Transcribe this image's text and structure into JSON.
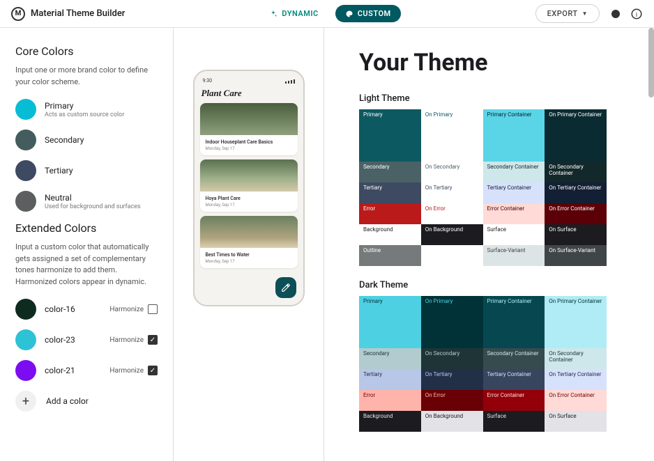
{
  "app_title": "Material Theme Builder",
  "modes": {
    "dynamic": "DYNAMIC",
    "custom": "CUSTOM"
  },
  "export_label": "EXPORT",
  "core_colors": {
    "title": "Core Colors",
    "description": "Input one or more brand color to define your color scheme.",
    "items": [
      {
        "name": "Primary",
        "sub": "Acts as custom source color",
        "hex": "#07bdd5"
      },
      {
        "name": "Secondary",
        "sub": "",
        "hex": "#445c5e"
      },
      {
        "name": "Tertiary",
        "sub": "",
        "hex": "#3d4a61"
      },
      {
        "name": "Neutral",
        "sub": "Used for background and surfaces",
        "hex": "#5c5f5f"
      }
    ]
  },
  "extended_colors": {
    "title": "Extended Colors",
    "description": "Input a custom color that automatically gets assigned a set of complementary tones harmonize to add them. Harmonized colors appear in dynamic.",
    "items": [
      {
        "name": "color-16",
        "hex": "#0f2b1f",
        "harmonize": false
      },
      {
        "name": "color-23",
        "hex": "#2ec2d6",
        "harmonize": true
      },
      {
        "name": "color-21",
        "hex": "#7c0df2",
        "harmonize": true
      }
    ],
    "harmonize_label": "Harmonize",
    "add_label": "Add a color"
  },
  "preview": {
    "time": "9:30",
    "app_name": "Plant Care",
    "cards": [
      {
        "title": "Indoor Houseplant Care Basics",
        "date": "Monday, Sep 17"
      },
      {
        "title": "Hoya Plant Care",
        "date": "Monday, Sep 17"
      },
      {
        "title": "Best Times to Water",
        "date": "Monday, Sep 17"
      }
    ]
  },
  "theme": {
    "heading": "Your Theme",
    "light_label": "Light Theme",
    "dark_label": "Dark Theme",
    "light": [
      [
        {
          "l": "Primary",
          "bg": "#0d5961",
          "fg": "#fff"
        },
        {
          "l": "On Primary",
          "bg": "#ffffff",
          "fg": "#0d5961"
        },
        {
          "l": "Primary Container",
          "bg": "#5ad5e8",
          "fg": "#05222a"
        },
        {
          "l": "On Primary Container",
          "bg": "#0a2b32",
          "fg": "#fff"
        }
      ],
      [
        {
          "l": "Secondary",
          "bg": "#4a6265",
          "fg": "#fff"
        },
        {
          "l": "On Secondary",
          "bg": "#ffffff",
          "fg": "#4a6265"
        },
        {
          "l": "Secondary Container",
          "bg": "#cde7ea",
          "fg": "#13282b"
        },
        {
          "l": "On Secondary Container",
          "bg": "#13282b",
          "fg": "#fff"
        }
      ],
      [
        {
          "l": "Tertiary",
          "bg": "#3d4a61",
          "fg": "#fff"
        },
        {
          "l": "On Tertiary",
          "bg": "#ffffff",
          "fg": "#3d4a61"
        },
        {
          "l": "Tertiary Container",
          "bg": "#d7e1fb",
          "fg": "#131f35"
        },
        {
          "l": "On Tertiary Container",
          "bg": "#131f35",
          "fg": "#fff"
        }
      ],
      [
        {
          "l": "Error",
          "bg": "#ba1a1a",
          "fg": "#fff"
        },
        {
          "l": "On Error",
          "bg": "#ffffff",
          "fg": "#ba1a1a"
        },
        {
          "l": "Error Container",
          "bg": "#ffdad6",
          "fg": "#410002"
        },
        {
          "l": "On Error Container",
          "bg": "#5c0007",
          "fg": "#fff"
        }
      ],
      [
        {
          "l": "Background",
          "bg": "#ffffff",
          "fg": "#1c1b1f"
        },
        {
          "l": "On Background",
          "bg": "#1c1b1f",
          "fg": "#fff"
        },
        {
          "l": "Surface",
          "bg": "#ffffff",
          "fg": "#1c1b1f"
        },
        {
          "l": "On Surface",
          "bg": "#1c1b1f",
          "fg": "#fff"
        }
      ],
      [
        {
          "l": "Outline",
          "bg": "#767a7b",
          "fg": "#fff"
        },
        {
          "l": "",
          "bg": "#ffffff",
          "fg": "#fff"
        },
        {
          "l": "Surface-Variant",
          "bg": "#dde4e5",
          "fg": "#404547"
        },
        {
          "l": "On Surface-Variant",
          "bg": "#404547",
          "fg": "#fff"
        }
      ]
    ],
    "dark": [
      [
        {
          "l": "Primary",
          "bg": "#4dd0e1",
          "fg": "#003238"
        },
        {
          "l": "On Primary",
          "bg": "#003238",
          "fg": "#4dd0e1"
        },
        {
          "l": "Primary Container",
          "bg": "#074850",
          "fg": "#b0ecf5"
        },
        {
          "l": "On Primary Container",
          "bg": "#b0ecf5",
          "fg": "#003238"
        }
      ],
      [
        {
          "l": "Secondary",
          "bg": "#b1cbce",
          "fg": "#1f3437"
        },
        {
          "l": "On Secondary",
          "bg": "#1f3437",
          "fg": "#b1cbce"
        },
        {
          "l": "Secondary Container",
          "bg": "#364b4e",
          "fg": "#cde7ea"
        },
        {
          "l": "On Secondary Container",
          "bg": "#cde7ea",
          "fg": "#1f3437"
        }
      ],
      [
        {
          "l": "Tertiary",
          "bg": "#b8c7e7",
          "fg": "#212f47"
        },
        {
          "l": "On Tertiary",
          "bg": "#212f47",
          "fg": "#b8c7e7"
        },
        {
          "l": "Tertiary Container",
          "bg": "#37455e",
          "fg": "#d7e1fb"
        },
        {
          "l": "On Tertiary Container",
          "bg": "#d7e1fb",
          "fg": "#212f47"
        }
      ],
      [
        {
          "l": "Error",
          "bg": "#ffb4ab",
          "fg": "#690005"
        },
        {
          "l": "On Error",
          "bg": "#690005",
          "fg": "#ffb4ab"
        },
        {
          "l": "Error Container",
          "bg": "#93000a",
          "fg": "#ffdad6"
        },
        {
          "l": "On Error Container",
          "bg": "#ffdad6",
          "fg": "#690005"
        }
      ],
      [
        {
          "l": "Background",
          "bg": "#1c1b1f",
          "fg": "#e3e2e6"
        },
        {
          "l": "On Background",
          "bg": "#e3e2e6",
          "fg": "#1c1b1f"
        },
        {
          "l": "Surface",
          "bg": "#1c1b1f",
          "fg": "#e3e2e6"
        },
        {
          "l": "On Surface",
          "bg": "#e3e2e6",
          "fg": "#1c1b1f"
        }
      ]
    ]
  }
}
